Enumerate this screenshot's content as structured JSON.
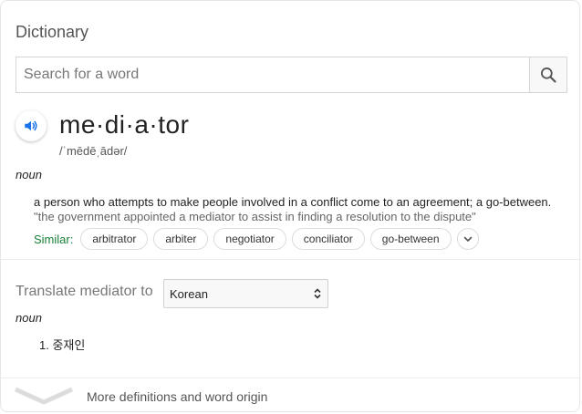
{
  "header": {
    "title": "Dictionary"
  },
  "search": {
    "placeholder": "Search for a word"
  },
  "entry": {
    "word": "me·di·a·tor",
    "phonetic": "/ˈmēdēˌādər/",
    "part_of_speech": "noun",
    "definition": "a person who attempts to make people involved in a conflict come to an agreement; a go-between.",
    "example": "\"the government appointed a mediator to assist in finding a resolution to the dispute\"",
    "similar_label": "Similar:",
    "similar": [
      "arbitrator",
      "arbiter",
      "negotiator",
      "conciliator",
      "go-between"
    ]
  },
  "translate": {
    "label": "Translate mediator to",
    "language": "Korean",
    "part_of_speech": "noun",
    "items": [
      {
        "number": "1.",
        "text": "중재인"
      }
    ]
  },
  "footer": {
    "more_label": "More definitions and word origin"
  },
  "colors": {
    "similar_label": "#188038",
    "speaker_icon": "#1a73e8"
  }
}
